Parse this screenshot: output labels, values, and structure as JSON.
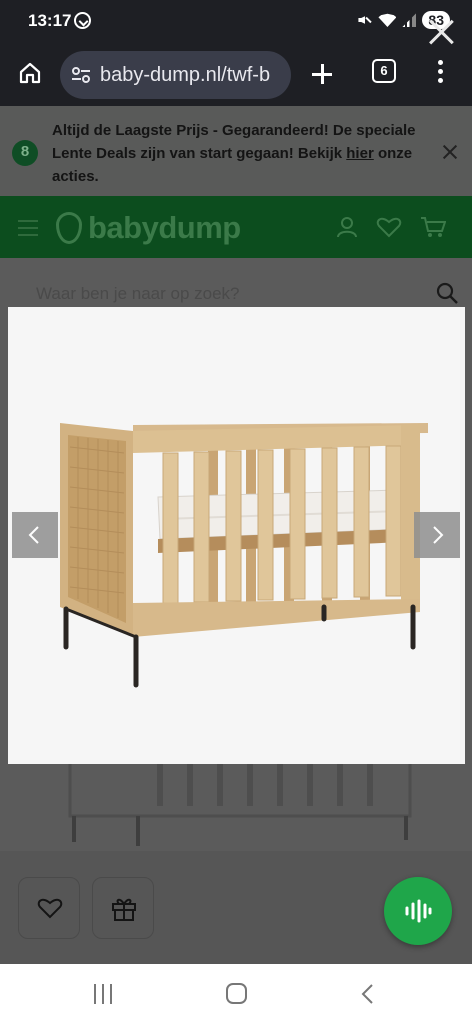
{
  "status_bar": {
    "time": "13:17",
    "battery": "83",
    "icons": [
      "whatsapp-icon",
      "mute-icon",
      "wifi-icon",
      "signal-icon"
    ]
  },
  "browser": {
    "url": "baby-dump.nl/twf-b",
    "tab_count": "6",
    "icons": [
      "home-icon",
      "tune-icon",
      "plus-icon",
      "tabs-button",
      "menu-icon"
    ]
  },
  "promo": {
    "text_before": "Altijd de Laagste Prijs - Gegarandeerd! De speciale Lente Deals zijn van start gegaan! Bekijk ",
    "link": "hier",
    "text_after": " onze acties."
  },
  "header": {
    "brand": "babydump",
    "icons": [
      "hamburger-icon",
      "user-icon",
      "heart-icon",
      "cart-icon"
    ]
  },
  "search": {
    "placeholder": "Waar ben je naar op zoek?"
  },
  "lightbox": {
    "image": "baby crib with rattan side panels",
    "controls": [
      "chevron-left-icon",
      "chevron-right-icon"
    ]
  },
  "bottom_bar": {
    "icons": [
      "heart-icon",
      "gift-icon"
    ]
  },
  "colors": {
    "status_bar": "#1e1f24",
    "url_pill": "#3a3d4a",
    "brand_green": "#0c4d1e",
    "voice_button": "#1fa64a",
    "lightbox_bg": "#f6f6f6",
    "nav_bar": "#ffffff"
  }
}
